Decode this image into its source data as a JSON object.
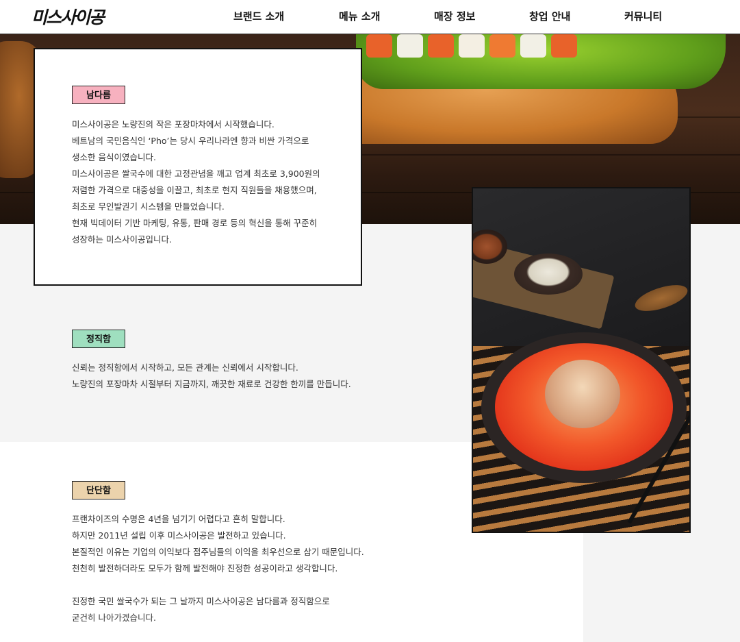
{
  "header": {
    "logo": "미스사이공",
    "nav": [
      "브랜드 소개",
      "메뉴 소개",
      "매장 정보",
      "창업 안내",
      "커뮤니티"
    ]
  },
  "colors": {
    "tag_namdareum": "#f7b1bf",
    "tag_jeongjik": "#9fdfbf",
    "tag_dandan": "#ecd3ac",
    "section_background": "#f4f4f4"
  },
  "sections": [
    {
      "tag": "남다름",
      "text": "미스사이공은 노량진의 작은 포장마차에서 시작했습니다.\n베트남의 국민음식인 ‘Pho’는 당시 우리나라엔 향과 비싼 가격으로\n생소한 음식이였습니다.\n미스사이공은 쌀국수에 대한 고정관념을 깨고 업계 최초로 3,900원의\n저렴한 가격으로 대중성을 이끌고, 최초로 현지 직원들을 채용했으며,\n최초로 무인발권기 시스템을 만들었습니다.\n현재 빅데이터 기반 마케팅, 유통, 판매 경로 등의 혁신을 통해 꾸준히\n성장하는 미스사이공입니다."
    },
    {
      "tag": "정직함",
      "text": "신뢰는 정직함에서 시작하고, 모든 관계는 신뢰에서 시작합니다.\n노량진의 포장마차 시절부터 지금까지, 깨끗한 재료로 건강한 한끼를 만듭니다."
    },
    {
      "tag": "단단함",
      "text": "프랜차이즈의 수명은 4년을 넘기기 어렵다고 흔히 말합니다.\n하지만 2011년 설립 이후 미스사이공은 발전하고 있습니다.\n본질적인 이유는 기업의 이익보다 점주님들의 이익을 최우선으로 삼기 때문입니다.\n천천히 발전하더라도 모두가 함께 발전해야 진정한 성공이라고 생각합니다.\n\n진정한 국민 쌀국수가 되는 그 날까지 미스사이공은 남다름과 정직함으로\n굳건히 나아가겠습니다."
    }
  ]
}
